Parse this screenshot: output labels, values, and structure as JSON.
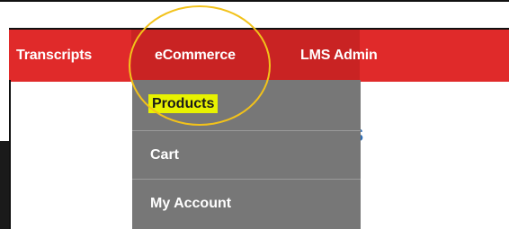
{
  "nav": {
    "items": [
      {
        "label": "Transcripts"
      },
      {
        "label": "eCommerce"
      },
      {
        "label": "LMS Admin"
      }
    ]
  },
  "dropdown": {
    "items": [
      {
        "label": "Products",
        "highlighted": true
      },
      {
        "label": "Cart"
      },
      {
        "label": "My Account"
      }
    ]
  },
  "page": {
    "heading_fragment": "ts"
  },
  "colors": {
    "accent": "#e02a2a",
    "active_bg": "#c92323",
    "menu_bg": "#777777",
    "divider": "#9a9a9a",
    "highlight": "#e8f200",
    "circle": "#f2c21a"
  }
}
